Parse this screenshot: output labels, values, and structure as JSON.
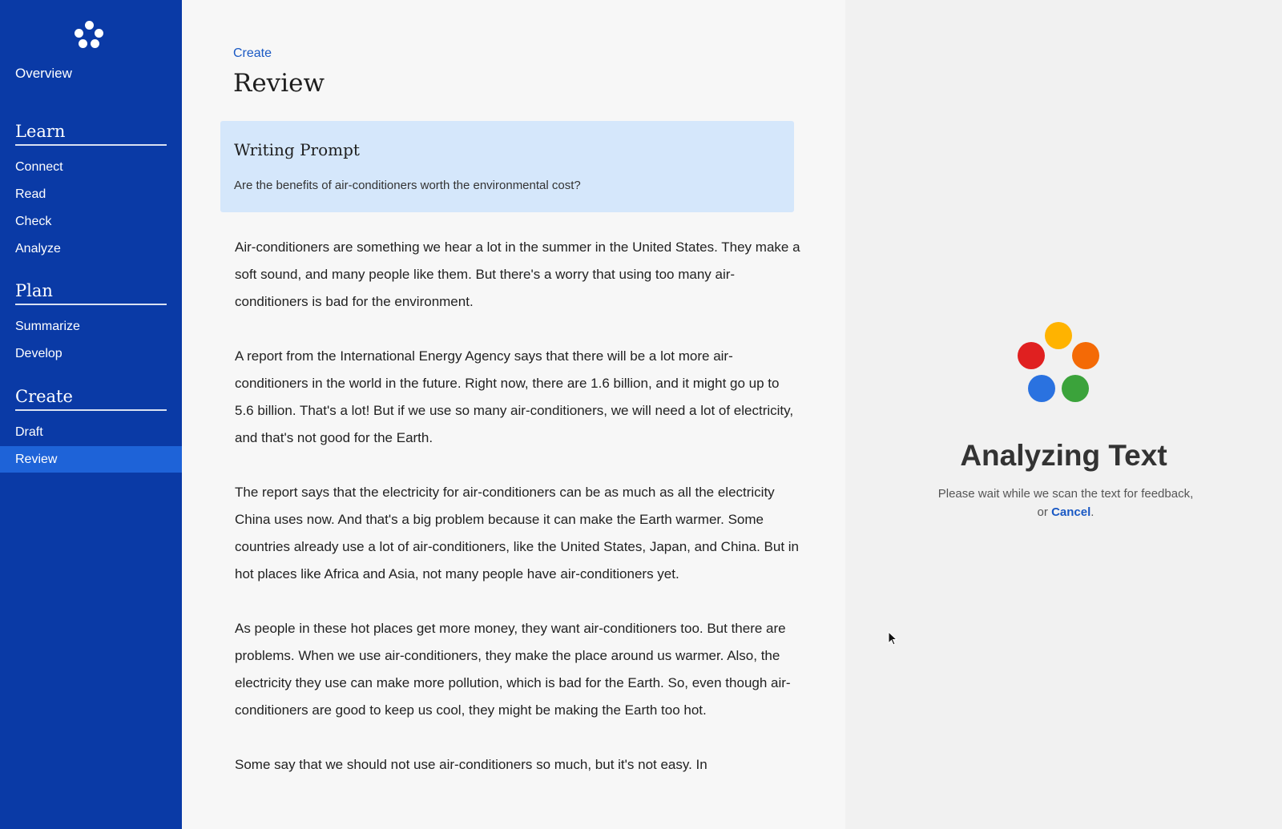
{
  "sidebar": {
    "overview": "Overview",
    "sections": [
      {
        "title": "Learn",
        "items": [
          "Connect",
          "Read",
          "Check",
          "Analyze"
        ]
      },
      {
        "title": "Plan",
        "items": [
          "Summarize",
          "Develop"
        ]
      },
      {
        "title": "Create",
        "items": [
          "Draft",
          "Review"
        ]
      }
    ],
    "active_item": "Review",
    "colors": {
      "background": "#0a3aa6",
      "active": "#1e63d8"
    }
  },
  "main": {
    "breadcrumb": "Create",
    "title": "Review",
    "prompt": {
      "heading": "Writing Prompt",
      "text": "Are the benefits of air-conditioners worth the environmental cost?"
    },
    "essay": [
      "Air-conditioners are something we hear a lot in the summer in the United States. They make a soft sound, and many people like them. But there's a worry that using too many air-conditioners is bad for the environment.",
      "A report from the International Energy Agency says that there will be a lot more air-conditioners in the world in the future. Right now, there are 1.6 billion, and it might go up to 5.6 billion. That's a lot! But if we use so many air-conditioners, we will need a lot of electricity, and that's not good for the Earth.",
      "The report says that the electricity for air-conditioners can be as much as all the electricity China uses now. And that's a big problem because it can make the Earth warmer. Some countries already use a lot of air-conditioners, like the United States, Japan, and China. But in hot places like Africa and Asia, not many people have air-conditioners yet.",
      "As people in these hot places get more money, they want air-conditioners too. But there are problems. When we use air-conditioners, they make the place around us warmer. Also, the electricity they use can make more pollution, which is bad for the Earth. So, even though air-conditioners are good to keep us cool, they might be making the Earth too hot.",
      "Some say that we should not use air-conditioners so much, but it's not easy. In"
    ]
  },
  "panel": {
    "title": "Analyzing Text",
    "message_before": "Please wait while we scan the text for feedback, or ",
    "cancel_label": "Cancel",
    "message_after": ".",
    "dot_colors": [
      "#ffb300",
      "#e02020",
      "#f46a06",
      "#2a72e0",
      "#3ba33b"
    ]
  }
}
